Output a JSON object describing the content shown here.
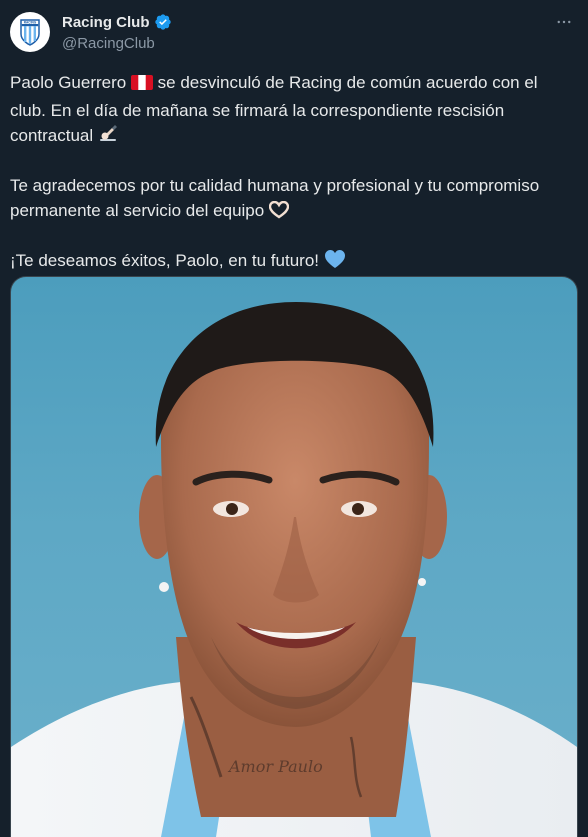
{
  "author": {
    "display_name": "Racing Club",
    "handle": "@RacingClub",
    "avatar_text": "RACING"
  },
  "tweet": {
    "p1_before_flag": "Paolo Guerrero ",
    "p1_after_flag": " se desvinculó de Racing de común acuerdo con el club. En el día de mañana se firmará la correspondiente rescisión contractual ",
    "p2": "Te agradecemos por tu calidad humana y profesional y tu compromiso permanente al servicio del equipo ",
    "p3": "¡Te deseamos éxitos, Paolo, en tu futuro! "
  },
  "icons": {
    "verified": "verified-badge-icon",
    "more": "more-options-icon",
    "flag": "peru-flag-emoji",
    "signing": "writing-hand-emoji",
    "hands": "heart-hands-emoji",
    "heart": "light-blue-heart-emoji"
  },
  "media": {
    "tattoo_text": "Amor Paulo"
  },
  "colors": {
    "background": "#15202b",
    "text": "#e7e9ea",
    "secondary": "#8b98a5",
    "verified": "#1d9bf0",
    "heart": "#6cb4ee"
  }
}
